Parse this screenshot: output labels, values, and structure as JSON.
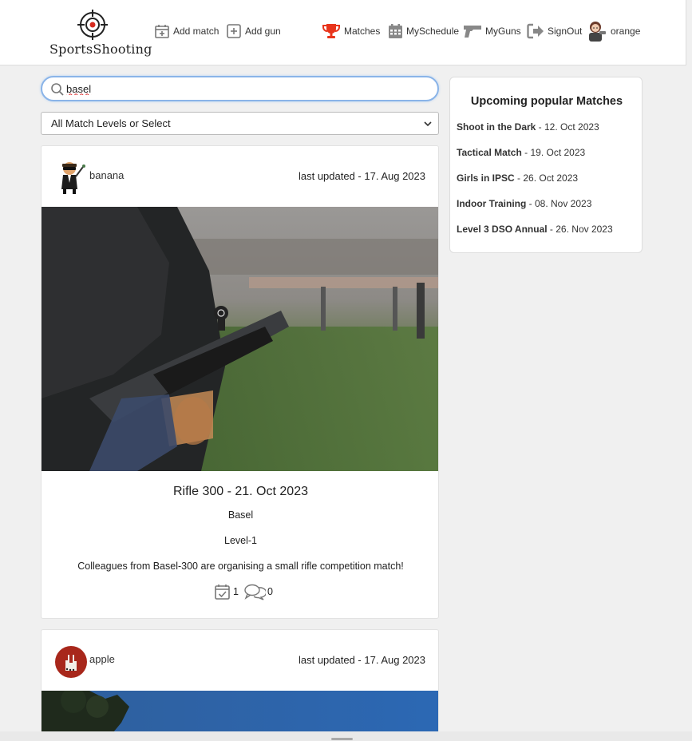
{
  "brand": {
    "name": "SportsShooting",
    "logo_icon": "crosshair-target-icon"
  },
  "nav": {
    "add_match": {
      "label": "Add match",
      "icon": "calendar-plus-icon"
    },
    "add_gun": {
      "label": "Add gun",
      "icon": "square-plus-icon"
    },
    "matches": {
      "label": "Matches",
      "icon": "trophy-icon",
      "color": "#e8341b"
    },
    "schedule": {
      "label": "MySchedule",
      "icon": "calendar-grid-icon"
    },
    "guns": {
      "label": "MyGuns",
      "icon": "pistol-icon"
    },
    "signout": {
      "label": "SignOut",
      "icon": "sign-out-icon"
    },
    "user": {
      "label": "orange",
      "icon": "user-avatar"
    }
  },
  "search": {
    "value": "basel",
    "icon": "search-icon"
  },
  "filter": {
    "selected": "All Match Levels or Select"
  },
  "cards": [
    {
      "author": "banana",
      "updated": "last updated - 17. Aug 2023",
      "title": "Rifle 300 - 21. Oct 2023",
      "location": "Basel",
      "level": "Level-1",
      "description": "Colleagues from Basel-300 are organising a small rifle competition match!",
      "participants": "1",
      "comments": "0"
    },
    {
      "author": "apple",
      "updated": "last updated - 17. Aug 2023"
    }
  ],
  "sidebar": {
    "title": "Upcoming popular Matches",
    "items": [
      {
        "name": "Shoot in the Dark",
        "date": " - 12. Oct 2023"
      },
      {
        "name": "Tactical Match",
        "date": " - 19. Oct 2023"
      },
      {
        "name": "Girls in IPSC",
        "date": " - 26. Oct 2023"
      },
      {
        "name": "Indoor Training",
        "date": " - 08. Nov 2023"
      },
      {
        "name": "Level 3 DSO Annual",
        "date": " - 26. Nov 2023"
      }
    ]
  }
}
